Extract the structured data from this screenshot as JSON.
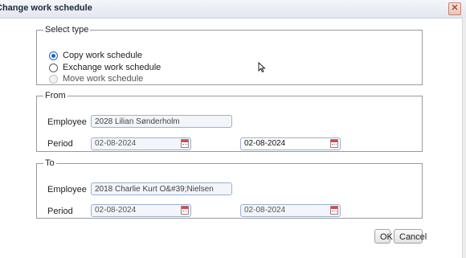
{
  "dialog": {
    "title": "Change work schedule",
    "close_symbol": "✕"
  },
  "select_type": {
    "legend": "Select type",
    "options": [
      {
        "label": "Copy work schedule",
        "checked": true,
        "disabled": false
      },
      {
        "label": "Exchange work schedule",
        "checked": false,
        "disabled": false
      },
      {
        "label": "Move work schedule",
        "checked": false,
        "disabled": true
      }
    ]
  },
  "from": {
    "legend": "From",
    "employee_label": "Employee",
    "employee_value": "2028 Lilian Sønderholm",
    "period_label": "Period",
    "period_start": "02-08-2024",
    "period_end": "02-08-2024"
  },
  "to": {
    "legend": "To",
    "employee_label": "Employee",
    "employee_value": "2018 Charlie Kurt O&#39;Nielsen",
    "period_label": "Period",
    "period_start": "02-08-2024",
    "period_end": "02-08-2024"
  },
  "buttons": {
    "ok_label": "OK",
    "cancel_label": "Cancel"
  },
  "icons": {
    "calendar": "calendar-icon",
    "close": "close-icon",
    "cursor": "mouse-pointer-icon"
  }
}
